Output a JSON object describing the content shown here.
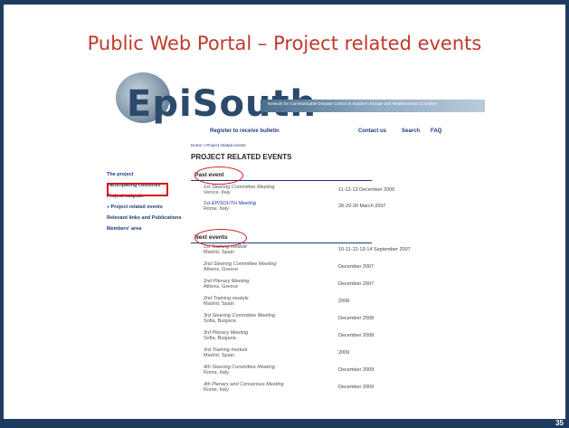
{
  "slide": {
    "title": "Public Web Portal – Project related events",
    "number": "35"
  },
  "site": {
    "logo_text": "EpiSouth",
    "tagline": "Network for Communicable Disease Control in Southern Europe and Mediterranean Countries",
    "topnav": [
      "Register to receive bulletin",
      "Contact us",
      "Search",
      "FAQ"
    ],
    "breadcrumb": "Home > Project related events",
    "page_heading": "PROJECT RELATED EVENTS",
    "sidenav": [
      "The project",
      "Participating countries",
      "Project outputs",
      "» Project related events",
      "Relevant links and Publications",
      "Members' area"
    ],
    "past_label": "Past event",
    "next_label": "Next events",
    "past_events": [
      {
        "name": "1st Steering Committee Meeting",
        "place": "Venice, Italy",
        "date": "11-12-13 December 2006"
      },
      {
        "name": "1st EPISOUTH Meeting",
        "place": "Rome, Italy",
        "date": "28-29-30 March 2007"
      }
    ],
    "next_events": [
      {
        "name": "1st Training module",
        "place": "Madrid, Spain",
        "date": "10-11-12-13-14 September 2007"
      },
      {
        "name": "2nd Steering Committee Meeting",
        "place": "Athens, Greece",
        "date": "December 2007"
      },
      {
        "name": "2nd Plenary Meeting",
        "place": "Athens, Greece",
        "date": "December 2007"
      },
      {
        "name": "2nd Training module",
        "place": "Madrid, Spain",
        "date": "2008"
      },
      {
        "name": "3rd Steering Committee Meeting",
        "place": "Sofia, Bulgaria",
        "date": "December 2008"
      },
      {
        "name": "3rd Plenary Meeting",
        "place": "Sofia, Bulgaria",
        "date": "December 2008"
      },
      {
        "name": "3rd Training module",
        "place": "Madrid, Spain",
        "date": "2009"
      },
      {
        "name": "4th Steering Committee Meeting",
        "place": "Rome, Italy",
        "date": "December 2009"
      },
      {
        "name": "4th Plenary and Consensus Meeting",
        "place": "Rome, Italy",
        "date": "December 2009"
      }
    ]
  },
  "colors": {
    "title_red": "#c0392b",
    "frame_navy": "#1f3a5f",
    "annotation_red": "#d9151b",
    "link_blue": "#1f3a7a"
  }
}
